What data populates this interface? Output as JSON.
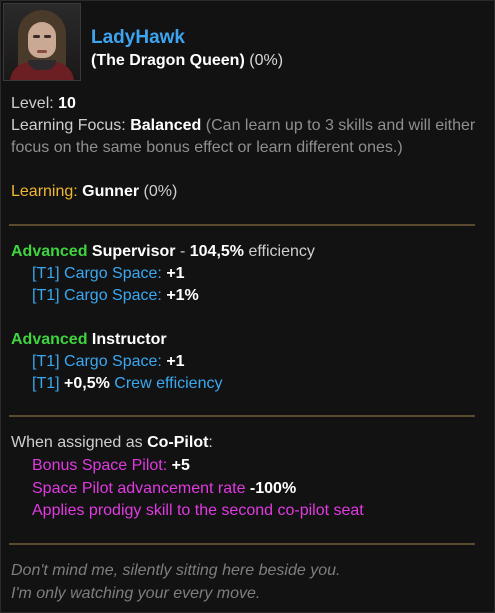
{
  "character": {
    "name": "LadyHawk",
    "title": "(The Dragon Queen)",
    "title_pct": "(0%)",
    "portrait_icon": "crew-portrait"
  },
  "stats": {
    "level_label": "Level:",
    "level_value": "10",
    "focus_label": "Learning Focus:",
    "focus_value": "Balanced",
    "focus_desc": "(Can learn up to 3 skills and will either focus on the same bonus effect or learn different ones.)",
    "learning_label": "Learning:",
    "learning_value": "Gunner",
    "learning_pct": "(0%)"
  },
  "skills": [
    {
      "tier": "Advanced",
      "name": "Supervisor",
      "suffix_prefix": "- ",
      "efficiency": "104,5%",
      "suffix_word": "efficiency",
      "effects": [
        {
          "tag": "[T1]",
          "text": "Cargo Space:",
          "value": "+1"
        },
        {
          "tag": "[T1]",
          "text": "Cargo Space:",
          "value": "+1%"
        }
      ]
    },
    {
      "tier": "Advanced",
      "name": "Instructor",
      "effects": [
        {
          "tag": "[T1]",
          "text": "Cargo Space:",
          "value": "+1"
        },
        {
          "tag": "[T1]",
          "value": "+0,5%",
          "text": "Crew efficiency"
        }
      ]
    }
  ],
  "copilot": {
    "intro": "When assigned as",
    "role": "Co-Pilot",
    "colon": ":",
    "bonuses": [
      {
        "text": "Bonus Space Pilot:",
        "value": "+5"
      },
      {
        "text": "Space Pilot advancement rate",
        "value": "-100%"
      },
      {
        "text": "Applies prodigy skill to the second co-pilot seat",
        "value": ""
      }
    ]
  },
  "flavor": {
    "line1": "Don't mind me, silently sitting here beside you.",
    "line2": "I'm only watching your every move."
  },
  "colors": {
    "name": "#3da4f0",
    "advanced": "#3fd43f",
    "tier_blue": "#3aa8f0",
    "copilot_pink": "#e03ae0",
    "learning_gold": "#f0b830",
    "divider": "#5a4a30"
  }
}
